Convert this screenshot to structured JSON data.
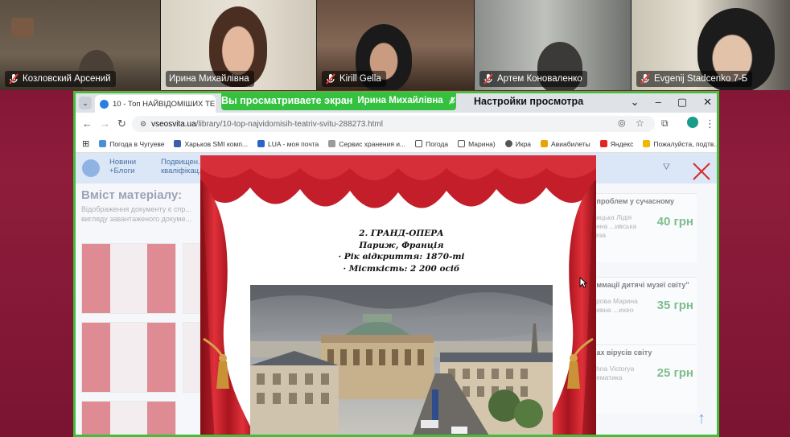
{
  "participants": [
    {
      "name": "Козловский Арсений",
      "muted": true
    },
    {
      "name": "Ирина Михайлівна",
      "muted": false,
      "active": true
    },
    {
      "name": "Kirill Gella",
      "muted": true
    },
    {
      "name": "Артем Коноваленко",
      "muted": true
    },
    {
      "name": "Evgenij Stadcenko 7-Б",
      "muted": true
    }
  ],
  "share_banner": {
    "prefix": "Вы просматриваете экран",
    "presenter": "Ирина Михайлівна",
    "settings_label": "Настройки просмотра"
  },
  "browser": {
    "tab_title": "10 - Топ НАЙВІДОМІШИХ ТЕ...",
    "url_host": "vseosvita.ua",
    "url_path": "/library/10-top-najvidomisih-teatriv-svitu-288273.html",
    "bookmarks": [
      "Погода в Чугуеве",
      "Харьков SMI комп...",
      "LUA - моя почта",
      "Сервис хранения и...",
      "Погода",
      "Марина)",
      "Икра",
      "Авиабилеты",
      "Яндекс",
      "Пожалуйста, подтв..."
    ]
  },
  "page": {
    "menu": [
      "Новини",
      "+Блоги",
      "Подвищен...",
      "кваліфікац..."
    ],
    "content_title": "Вміст матеріалу:",
    "content_sub": "Відображення документу є спр... вигляду завантаженого докуме...",
    "side_cards": [
      {
        "title": "...проблем у сучасному",
        "author": "...ицька Лідія ...нна ...ивська меза",
        "price": "40 грн"
      },
      {
        "title": "...ммації дитячі музеї світу\"",
        "author": "...рова Марина ...ивна ...ихео",
        "price": "35 грн"
      },
      {
        "title": "...ах вірусів світу",
        "author": "...hna Victorya ...ематика",
        "price": "25 грн"
      }
    ]
  },
  "slide": {
    "lines": [
      "2. ГРАНД-ОПЕРА",
      "Париж, Франція",
      "·   Рік відкриття: 1870-ті",
      "·   Місткість: 2 200 осіб"
    ]
  },
  "colors": {
    "share_border": "#3fbf3a",
    "curtain": "#c8222e",
    "background": "#8e1d3b"
  }
}
